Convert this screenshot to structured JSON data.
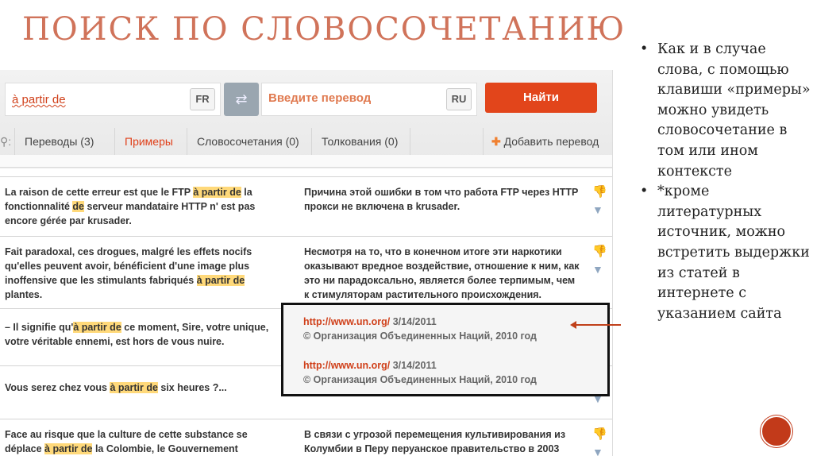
{
  "slide": {
    "title": "Поиск по словосочетанию",
    "notes": [
      "Как и в случае слова, с помощью клавиши «примеры» можно увидеть словосочетание в том или ином контексте",
      "*кроме литературных источник, можно встретить выдержки из статей в интернете с указанием сайта"
    ]
  },
  "search": {
    "query": "à partir de",
    "src_lang": "FR",
    "placeholder": "Введите перевод",
    "dst_lang": "RU",
    "find": "Найти",
    "swap_icon": "⇄"
  },
  "tabs": [
    "Переводы (3)",
    "Примеры",
    "Словосочетания (0)",
    "Толкования (0)"
  ],
  "add_translation": "Добавить перевод",
  "rows": [
    {
      "src": [
        [
          "La raison de cette erreur est que le FTP ",
          0
        ],
        [
          "à partir de",
          1
        ],
        [
          " la fonctionnalité ",
          0
        ],
        [
          "de",
          1
        ],
        [
          " serveur mandataire HTTP n' est pas encore gérée par krusader.",
          0
        ]
      ],
      "tr": "Причина этой ошибки в том что работа FTP через HTTP прокси не включена в krusader."
    },
    {
      "src": [
        [
          "Fait paradoxal, ces drogues, malgré les effets nocifs qu'elles peuvent avoir, bénéficient d'une image plus inoffensive que les stimulants fabriqués ",
          0
        ],
        [
          "à partir de",
          1
        ],
        [
          " plantes.",
          0
        ]
      ],
      "tr": "Несмотря на то, что в конечном итоге эти наркотики оказывают вредное воздействие, отношение к ним, как это ни парадоксально, является более терпимым, чем к стимуляторам растительного происхождения."
    },
    {
      "src": [
        [
          "– Il signifie qu'",
          0
        ],
        [
          "à partir de",
          1
        ],
        [
          " ce moment, Sire, votre unique, votre véritable ennemi, est hors de vous nuire.",
          0
        ]
      ],
      "tr": ""
    },
    {
      "src": [
        [
          "Vous serez chez vous ",
          0
        ],
        [
          "à partir de",
          1
        ],
        [
          " six heures ?...",
          0
        ]
      ],
      "tr": ""
    },
    {
      "src": [
        [
          "Face au risque que la culture de cette substance se déplace ",
          0
        ],
        [
          "à partir de",
          1
        ],
        [
          " la Colombie, le Gouvernement",
          0
        ]
      ],
      "tr": "В связи с угрозой перемещения культивирования из Колумбии в Перу перуанское правительство в 2003"
    }
  ],
  "sources": [
    {
      "link": "http://www.un.org/",
      "date": "3/14/2011",
      "copy": "© Организация Объединенных Наций, 2010 год"
    },
    {
      "link": "http://www.un.org/",
      "date": "3/14/2011",
      "copy": "© Организация Объединенных Наций, 2010 год"
    }
  ]
}
